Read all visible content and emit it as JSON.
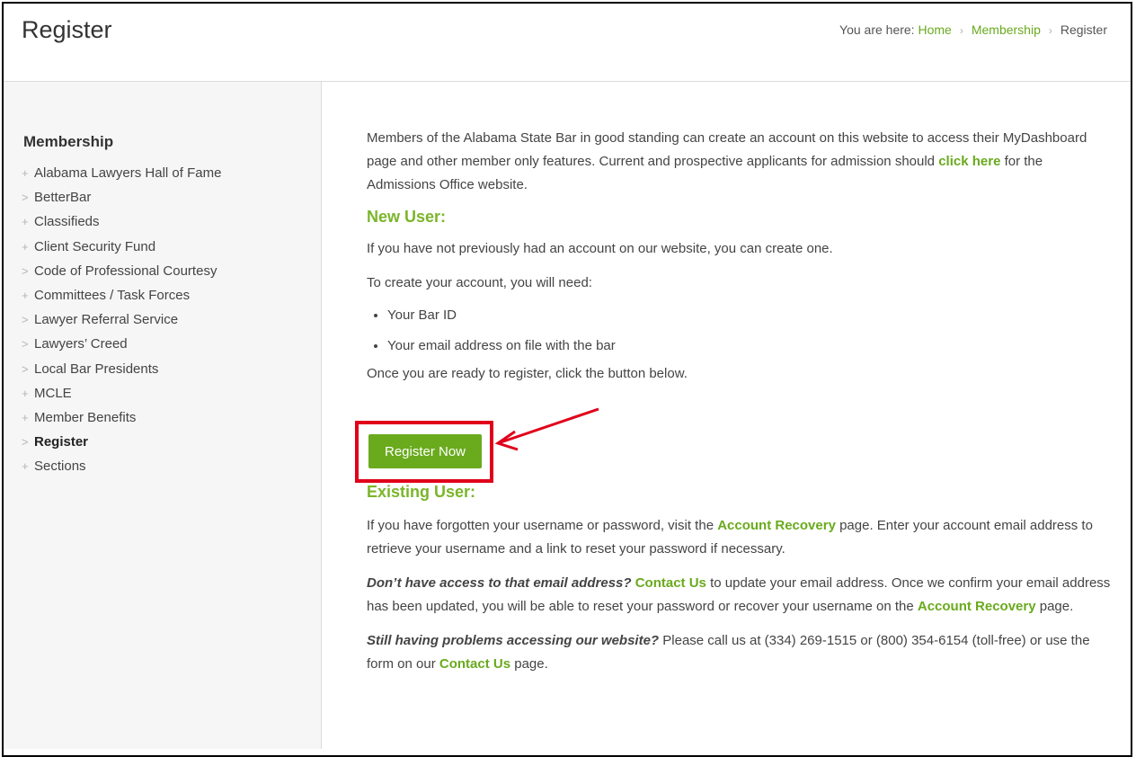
{
  "header": {
    "title": "Register",
    "breadcrumb": {
      "prefix": "You are here:",
      "home": "Home",
      "section": "Membership",
      "current": "Register"
    }
  },
  "sidebar": {
    "heading": "Membership",
    "items": [
      {
        "label": "Alabama Lawyers Hall of Fame",
        "marker": "+"
      },
      {
        "label": "BetterBar",
        "marker": ">"
      },
      {
        "label": "Classifieds",
        "marker": "+"
      },
      {
        "label": "Client Security Fund",
        "marker": "+"
      },
      {
        "label": "Code of Professional Courtesy",
        "marker": ">"
      },
      {
        "label": "Committees / Task Forces",
        "marker": "+"
      },
      {
        "label": "Lawyer Referral Service",
        "marker": ">"
      },
      {
        "label": "Lawyers’ Creed",
        "marker": ">"
      },
      {
        "label": "Local Bar Presidents",
        "marker": ">"
      },
      {
        "label": "MCLE",
        "marker": "+"
      },
      {
        "label": "Member Benefits",
        "marker": "+"
      },
      {
        "label": "Register",
        "marker": ">",
        "active": true
      },
      {
        "label": "Sections",
        "marker": "+"
      }
    ]
  },
  "content": {
    "intro_before_link": "Members of the Alabama State Bar in good standing can create an account on this website to access their MyDashboard page and other member only features. Current and prospective applicants for admission should",
    "intro_link": "click here",
    "intro_after_link": "for the Admissions Office website.",
    "new_user_heading": "New User:",
    "new_user_text": "If you have not previously had an account on our website, you can create one.",
    "need_text": "To create your account, you will need:",
    "needs": [
      "Your Bar ID",
      "Your email address on file with the bar"
    ],
    "ready_text": "Once you are ready to register, click the button below.",
    "register_button": "Register Now",
    "existing_heading": "Existing User:",
    "existing_before": "If you have forgotten your username or password, visit the",
    "account_recovery": "Account Recovery",
    "existing_after": "page. Enter your account email address to retrieve your username and a link to reset your password if necessary.",
    "no_access_q": "Don’t have access to that email address?",
    "contact_us": "Contact Us",
    "no_access_after": "to update your email address. Once we confirm your email address has been updated, you will be able to reset your password or recover your username on the",
    "page_word": "page.",
    "still_q": "Still having problems accessing our website?",
    "still_text": "Please call us at (334) 269-1515 or (800) 354-6154 (toll-free) or use the form on our",
    "highlight_color": "#e0001a",
    "accent_color": "#6aaa1d"
  }
}
